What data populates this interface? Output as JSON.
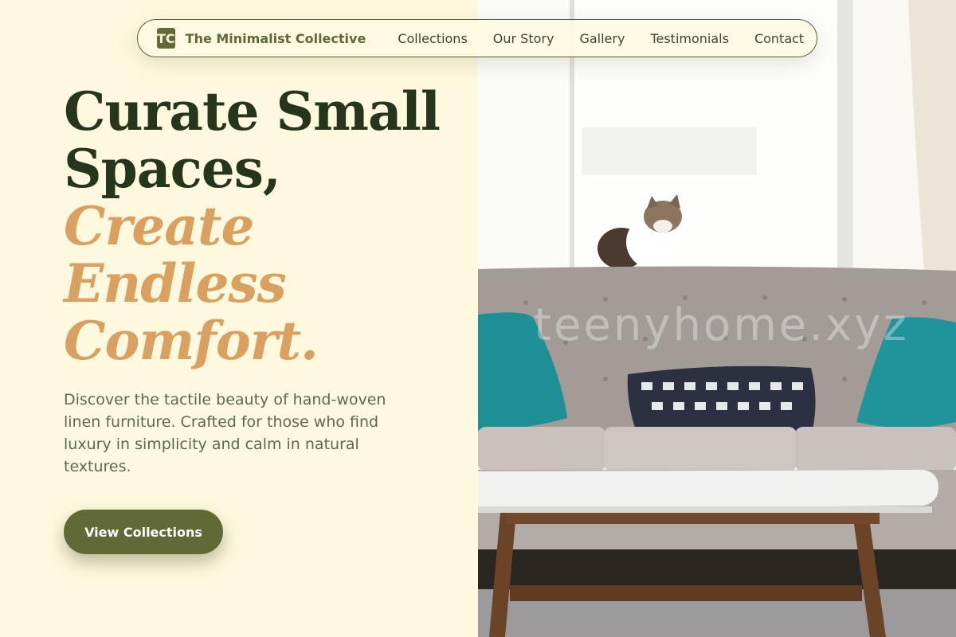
{
  "brand": {
    "badge": "TC",
    "name": "The Minimalist Collective"
  },
  "nav": {
    "items": [
      "Collections",
      "Our Story",
      "Gallery",
      "Testimonials",
      "Contact"
    ]
  },
  "hero": {
    "headline_line1": "Curate Small",
    "headline_line2": "Spaces,",
    "accent_line1": "Create",
    "accent_line2": "Endless",
    "accent_line3": "Comfort.",
    "description": "Discover the tactile beauty of hand-woven linen furniture. Crafted for those who find luxury in simplicity and calm in natural textures.",
    "cta_label": "View Collections"
  },
  "photo": {
    "watermark": "teenyhome.xyz"
  },
  "colors": {
    "background": "#fef8de",
    "headline": "#25361c",
    "accent": "#d9a060",
    "primary": "#616a37",
    "body_text": "#5c6a4c"
  }
}
